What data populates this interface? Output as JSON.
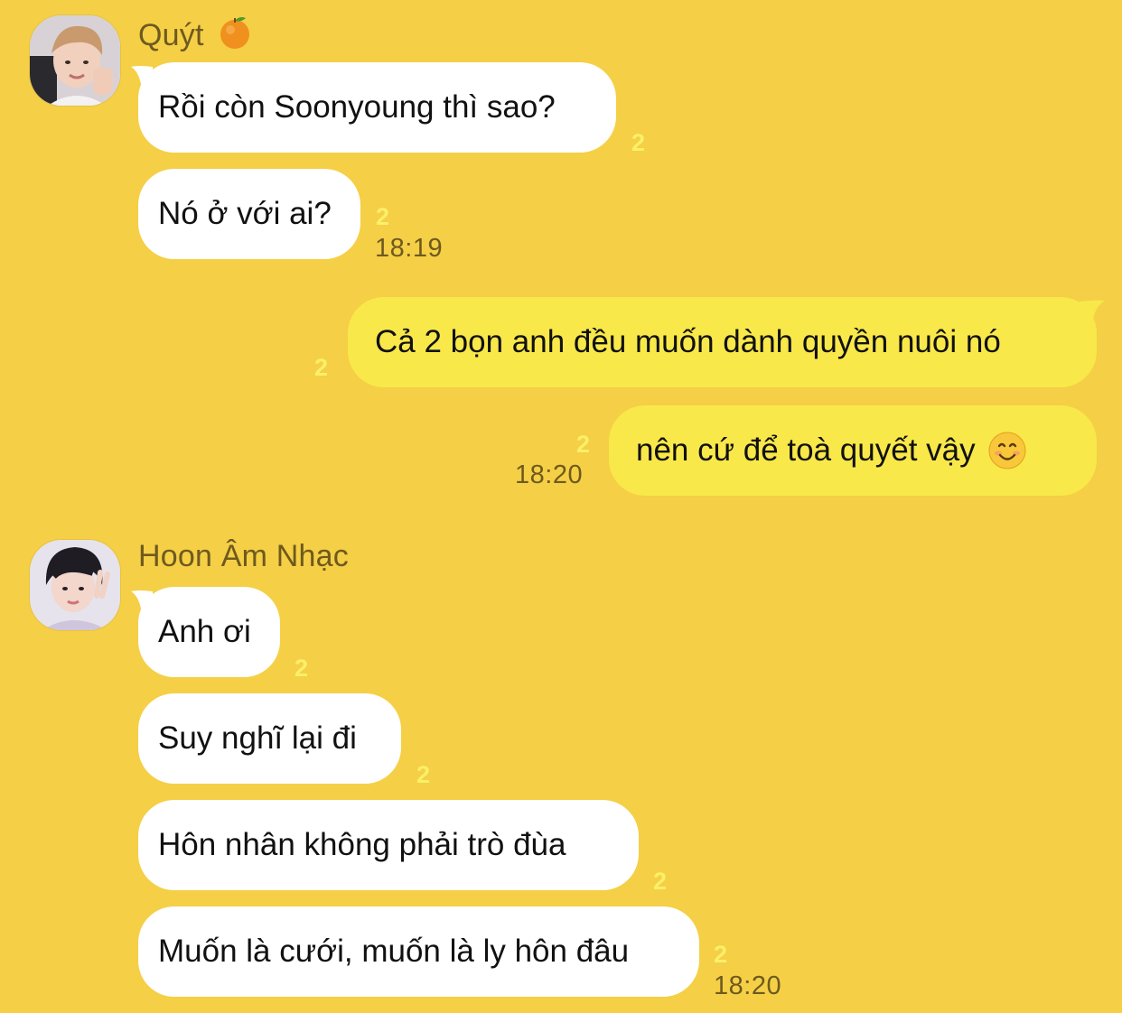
{
  "senders": {
    "quyt": {
      "name": "Quýt",
      "emoji": "tangerine-icon"
    },
    "hoon": {
      "name": "Hoon Âm Nhạc"
    }
  },
  "messages": [
    {
      "text": "Rồi còn Soonyoung thì sao?",
      "unread": "2"
    },
    {
      "text": "Nó ở với ai?",
      "unread": "2",
      "time": "18:19"
    },
    {
      "text": "Cả 2 bọn anh đều muốn dành quyền nuôi nó",
      "unread": "2"
    },
    {
      "text": "nên cứ để toà quyết vậy",
      "emoji": "smiling-face-icon",
      "unread": "2",
      "time": "18:20"
    },
    {
      "text": "Anh ơi",
      "unread": "2"
    },
    {
      "text": "Suy nghĩ lại đi",
      "unread": "2"
    },
    {
      "text": "Hôn nhân không phải trò đùa",
      "unread": "2"
    },
    {
      "text": "Muốn là cưới, muốn là ly hôn đâu",
      "unread": "2",
      "time": "18:20"
    }
  ],
  "colors": {
    "background": "#F5CF45",
    "incoming_bubble": "#FFFFFF",
    "outgoing_bubble": "#F9E84A",
    "name_text": "#6E5A1F",
    "unread_text": "#FAF06A"
  }
}
